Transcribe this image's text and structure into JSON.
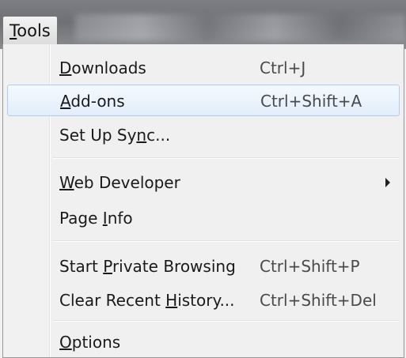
{
  "menubar": {
    "tools_menu": {
      "pre": "",
      "mnemonic": "T",
      "post": "ools"
    }
  },
  "menu": {
    "items": [
      {
        "pre": "",
        "mnemonic": "D",
        "post": "ownloads",
        "shortcut": "Ctrl+J",
        "highlighted": false
      },
      {
        "pre": "",
        "mnemonic": "A",
        "post": "dd-ons",
        "shortcut": "Ctrl+Shift+A",
        "highlighted": true
      },
      {
        "pre": "Set Up Sy",
        "mnemonic": "n",
        "post": "c...",
        "shortcut": "",
        "highlighted": false
      },
      {
        "pre": "",
        "mnemonic": "W",
        "post": "eb Developer",
        "shortcut": "",
        "has_submenu": true,
        "highlighted": false
      },
      {
        "pre": "Page ",
        "mnemonic": "I",
        "post": "nfo",
        "shortcut": "",
        "highlighted": false
      },
      {
        "pre": "Start ",
        "mnemonic": "P",
        "post": "rivate Browsing",
        "shortcut": "Ctrl+Shift+P",
        "highlighted": false
      },
      {
        "pre": "Clear Recent ",
        "mnemonic": "H",
        "post": "istory...",
        "shortcut": "Ctrl+Shift+Del",
        "highlighted": false
      },
      {
        "pre": "",
        "mnemonic": "O",
        "post": "ptions",
        "shortcut": "",
        "highlighted": false
      }
    ]
  },
  "colors": {
    "highlight_border": "#aeccf1",
    "highlight_fill": "#e2eefb",
    "menu_background": "#f0f0f0"
  }
}
